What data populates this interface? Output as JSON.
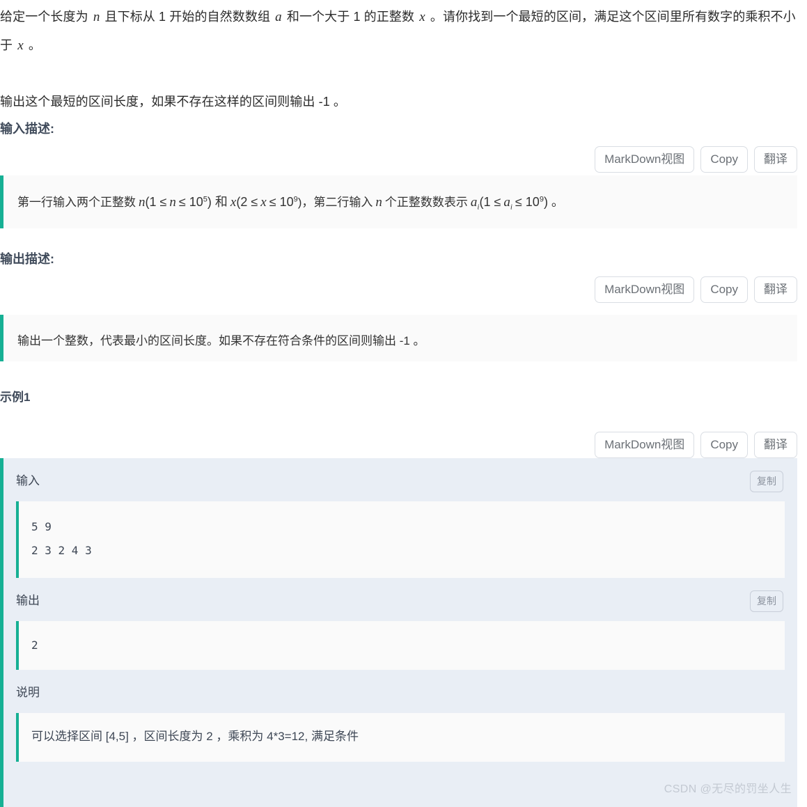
{
  "statement": {
    "paragraph1_parts": {
      "p1": "给定一个长度为",
      "var_n": "n",
      "p2": "且下标从 1 开始的自然数数组",
      "var_a": "a",
      "p3": "和一个大于 1 的正整数",
      "var_x": "x",
      "p4": "。请你找到一个最短的区间，满足这个区间里所有数字的乘积不小于",
      "var_x2": "x",
      "p5": "。"
    },
    "paragraph1_full": "给定一个长度为 n 且下标从 1 开始的自然数数组 a 和一个大于 1 的正整数 x。请你找到一个最短的区间，满足这个区间里所有数字的乘积不小于 x。",
    "paragraph2": "输出这个最短的区间长度，如果不存在这样的区间则输出 -1 。"
  },
  "sections": {
    "input_description_title": "输入描述:",
    "output_description_title": "输出描述:",
    "sample_title": "示例1"
  },
  "toolbar": {
    "markdown_label": "MarkDown视图",
    "copy_label": "Copy",
    "translate_label": "翻译"
  },
  "input_description": {
    "t1": "第一行输入两个正整数",
    "var_n": "n",
    "t2": "(1 ≤",
    "var_n2": "n",
    "t3": "≤ 10",
    "exp1": "5",
    "t4": ") 和",
    "var_x": "x",
    "t5": "(2 ≤",
    "var_x2": "x",
    "t6": "≤ 10",
    "exp2": "9",
    "t7": ")，第二行输入",
    "var_n3": "n",
    "t8": "个正整数数表示",
    "var_a": "a",
    "sub_i": "i",
    "t9": "(1 ≤",
    "var_a2": "a",
    "sub_i2": "i",
    "t10": "≤ 10",
    "exp3": "9",
    "t11": ") 。",
    "full_text": "第一行输入两个正整数 n(1 ≤ n ≤ 10^5) 和 x(2 ≤ x ≤ 10^9)，第二行输入 n 个正整数数表示 a_i(1 ≤ a_i ≤ 10^9) 。"
  },
  "output_description": {
    "full_text": "输出一个整数，代表最小的区间长度。如果不存在符合条件的区间则输出 -1  。"
  },
  "sample": {
    "copy_label": "复制",
    "input_label": "输入",
    "input_value": "5 9\n2 3 2 4 3",
    "output_label": "输出",
    "output_value": "2",
    "note_label": "说明",
    "note_value": "可以选择区间 [4,5] ，区间长度为 2 ，乘积为 4*3=12, 满足条件"
  },
  "watermark": {
    "text": "CSDN @无尽的罚坐人生"
  },
  "colors": {
    "accent_teal": "#16b094",
    "heading_slate": "#3f4a5a",
    "panel_bg": "#e9eef5",
    "code_bg": "#fafafa",
    "watermark": "#c3c9d2"
  }
}
